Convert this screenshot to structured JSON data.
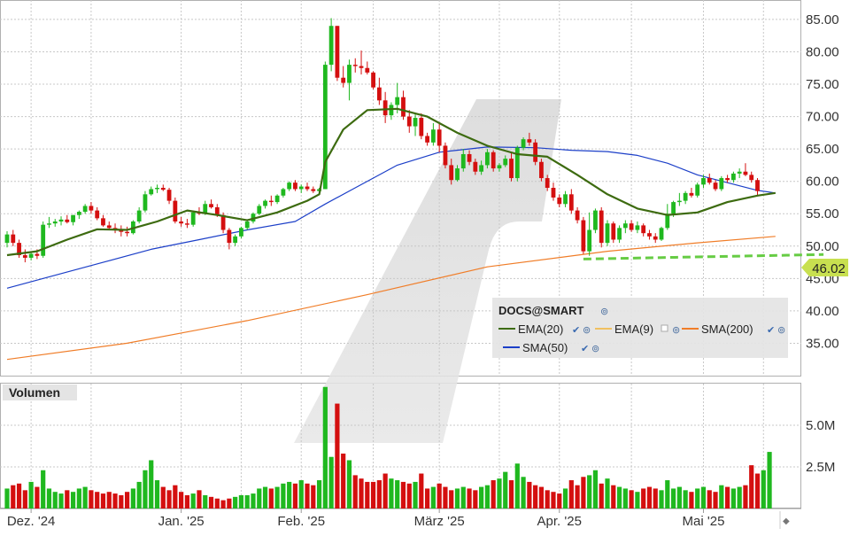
{
  "colors": {
    "up": "#1fb81f",
    "down": "#d40f0f",
    "ema20": "#3d6b10",
    "ema9": "#f0c060",
    "sma200": "#f07d28",
    "sma50": "#1c3fc8",
    "trend": "#66cc44",
    "last_badge": "#c8e050"
  },
  "legend": {
    "symbol": "DOCS@SMART",
    "items": [
      {
        "label": "EMA(20)",
        "color": "#3d6b10"
      },
      {
        "label": "EMA(9)",
        "color": "#f0c060"
      },
      {
        "label": "SMA(200)",
        "color": "#f07d28"
      },
      {
        "label": "SMA(50)",
        "color": "#1c3fc8"
      }
    ]
  },
  "volume_panel": {
    "title": "Volumen"
  },
  "last_price_label": "46.02",
  "chart_data": [
    {
      "type": "candlestick",
      "panel": "price",
      "ylim": [
        30,
        88
      ],
      "yticks": [
        35,
        40,
        45,
        50,
        55,
        60,
        65,
        70,
        75,
        80,
        85
      ],
      "ytick_labels": [
        "35.00",
        "40.00",
        "45.00",
        "50.00",
        "55.00",
        "60.00",
        "65.00",
        "70.00",
        "75.00",
        "80.00",
        "85.00"
      ],
      "x_labels": [
        {
          "label": "Dez. '24",
          "index": 4
        },
        {
          "label": "Jan. '25",
          "index": 29
        },
        {
          "label": "Feb. '25",
          "index": 49
        },
        {
          "label": "März '25",
          "index": 72
        },
        {
          "label": "Apr. '25",
          "index": 92
        },
        {
          "label": "Mai '25",
          "index": 116
        }
      ],
      "grid": true,
      "candles": [
        [
          50.5,
          52.3,
          49.8,
          51.8
        ],
        [
          51.8,
          52.5,
          50.0,
          50.5
        ],
        [
          50.5,
          51.0,
          48.2,
          48.6
        ],
        [
          48.6,
          49.5,
          47.5,
          48.2
        ],
        [
          48.2,
          49.0,
          47.8,
          48.8
        ],
        [
          48.8,
          49.5,
          48.0,
          48.5
        ],
        [
          48.5,
          53.8,
          48.2,
          53.3
        ],
        [
          53.3,
          54.5,
          52.8,
          53.5
        ],
        [
          53.5,
          54.2,
          53.0,
          53.8
        ],
        [
          53.8,
          54.6,
          53.2,
          54.1
        ],
        [
          54.1,
          54.8,
          53.5,
          53.7
        ],
        [
          53.7,
          54.5,
          53.2,
          54.8
        ],
        [
          54.8,
          55.5,
          54.2,
          55.3
        ],
        [
          55.3,
          56.5,
          55.0,
          56.2
        ],
        [
          56.2,
          56.8,
          55.0,
          55.5
        ],
        [
          55.5,
          56.0,
          54.0,
          54.3
        ],
        [
          54.3,
          54.8,
          53.0,
          53.2
        ],
        [
          53.2,
          53.8,
          52.5,
          52.8
        ],
        [
          52.8,
          53.5,
          52.0,
          52.6
        ],
        [
          52.6,
          53.2,
          51.5,
          52.2
        ],
        [
          52.2,
          53.0,
          51.5,
          52.0
        ],
        [
          52.0,
          54.0,
          51.8,
          53.8
        ],
        [
          53.8,
          56.0,
          53.5,
          55.5
        ],
        [
          55.5,
          58.5,
          55.2,
          58.0
        ],
        [
          58.0,
          59.2,
          57.8,
          58.8
        ],
        [
          58.8,
          59.5,
          58.2,
          59.0
        ],
        [
          59.0,
          59.5,
          58.5,
          58.7
        ],
        [
          58.7,
          59.0,
          56.5,
          57.0
        ],
        [
          57.0,
          57.5,
          53.5,
          53.8
        ],
        [
          53.8,
          54.5,
          53.0,
          53.5
        ],
        [
          53.5,
          54.2,
          52.8,
          53.3
        ],
        [
          53.3,
          55.5,
          53.0,
          55.2
        ],
        [
          55.2,
          56.0,
          54.8,
          55.0
        ],
        [
          55.0,
          57.0,
          54.8,
          56.5
        ],
        [
          56.5,
          57.2,
          55.8,
          56.0
        ],
        [
          56.0,
          56.5,
          54.5,
          54.8
        ],
        [
          54.8,
          55.2,
          52.0,
          52.5
        ],
        [
          52.5,
          52.8,
          49.5,
          50.5
        ],
        [
          50.5,
          51.8,
          50.0,
          51.5
        ],
        [
          51.5,
          53.0,
          51.2,
          52.8
        ],
        [
          52.8,
          54.0,
          52.5,
          53.8
        ],
        [
          53.8,
          55.2,
          53.5,
          55.0
        ],
        [
          55.0,
          56.5,
          54.8,
          56.2
        ],
        [
          56.2,
          57.2,
          55.8,
          57.0
        ],
        [
          57.0,
          57.8,
          56.2,
          56.8
        ],
        [
          56.8,
          58.0,
          56.5,
          57.8
        ],
        [
          57.8,
          59.0,
          57.5,
          58.8
        ],
        [
          58.8,
          60.0,
          58.5,
          59.8
        ],
        [
          59.8,
          60.2,
          58.5,
          58.8
        ],
        [
          58.8,
          59.5,
          58.2,
          59.2
        ],
        [
          59.2,
          59.8,
          58.5,
          58.8
        ],
        [
          58.8,
          59.2,
          58.2,
          58.5
        ],
        [
          58.5,
          59.0,
          58.0,
          58.8
        ],
        [
          58.8,
          78.5,
          71.5,
          78.0
        ],
        [
          78.0,
          85.2,
          77.0,
          84.0
        ],
        [
          84.0,
          82.0,
          75.5,
          76.0
        ],
        [
          76.0,
          77.8,
          74.5,
          75.2
        ],
        [
          75.2,
          78.8,
          72.5,
          78.0
        ],
        [
          78.0,
          79.0,
          76.8,
          77.8
        ],
        [
          77.8,
          80.2,
          76.5,
          77.5
        ],
        [
          77.5,
          78.5,
          76.5,
          76.8
        ],
        [
          76.8,
          77.0,
          74.2,
          74.5
        ],
        [
          74.5,
          76.0,
          71.8,
          72.5
        ],
        [
          72.5,
          73.8,
          69.0,
          70.2
        ],
        [
          70.2,
          72.2,
          69.5,
          71.8
        ],
        [
          71.8,
          75.2,
          70.5,
          73.0
        ],
        [
          73.0,
          74.0,
          69.5,
          70.0
        ],
        [
          70.0,
          71.0,
          67.5,
          68.5
        ],
        [
          68.5,
          70.5,
          67.0,
          69.8
        ],
        [
          69.8,
          70.5,
          66.5,
          67.0
        ],
        [
          67.0,
          67.5,
          65.5,
          66.0
        ],
        [
          66.0,
          69.0,
          65.5,
          68.0
        ],
        [
          68.0,
          69.0,
          64.5,
          65.5
        ],
        [
          65.5,
          66.0,
          62.0,
          62.5
        ],
        [
          62.5,
          63.5,
          59.5,
          60.2
        ],
        [
          60.2,
          62.5,
          60.0,
          62.0
        ],
        [
          62.0,
          65.0,
          61.5,
          64.2
        ],
        [
          64.2,
          64.8,
          62.5,
          63.0
        ],
        [
          63.0,
          63.5,
          61.0,
          61.5
        ],
        [
          61.5,
          63.2,
          61.0,
          62.5
        ],
        [
          62.5,
          65.0,
          62.0,
          64.5
        ],
        [
          64.5,
          64.8,
          61.5,
          62.0
        ],
        [
          62.0,
          62.8,
          61.5,
          62.5
        ],
        [
          62.5,
          64.0,
          62.2,
          63.5
        ],
        [
          63.5,
          64.5,
          60.0,
          60.5
        ],
        [
          60.5,
          65.5,
          60.0,
          65.2
        ],
        [
          65.2,
          66.8,
          64.8,
          66.5
        ],
        [
          66.5,
          67.5,
          65.5,
          66.0
        ],
        [
          66.0,
          66.5,
          62.5,
          63.0
        ],
        [
          63.0,
          63.5,
          60.0,
          60.5
        ],
        [
          60.5,
          61.0,
          58.5,
          59.0
        ],
        [
          59.0,
          59.8,
          57.0,
          57.5
        ],
        [
          57.5,
          58.0,
          56.0,
          56.5
        ],
        [
          56.5,
          58.5,
          56.0,
          58.0
        ],
        [
          58.0,
          58.8,
          55.0,
          55.5
        ],
        [
          55.5,
          56.0,
          53.5,
          54.0
        ],
        [
          54.0,
          54.5,
          48.8,
          49.2
        ],
        [
          49.2,
          55.2,
          48.5,
          52.5
        ],
        [
          52.5,
          55.8,
          52.0,
          55.5
        ],
        [
          55.5,
          56.0,
          49.8,
          50.5
        ],
        [
          50.5,
          54.0,
          50.0,
          53.5
        ],
        [
          53.5,
          53.8,
          50.5,
          51.0
        ],
        [
          51.0,
          53.2,
          50.5,
          52.8
        ],
        [
          52.8,
          54.0,
          52.0,
          53.5
        ],
        [
          53.5,
          54.0,
          52.2,
          52.5
        ],
        [
          52.5,
          53.8,
          52.0,
          53.2
        ],
        [
          53.2,
          53.5,
          51.5,
          52.0
        ],
        [
          52.0,
          52.5,
          51.0,
          51.5
        ],
        [
          51.5,
          52.0,
          50.5,
          51.0
        ],
        [
          51.0,
          53.0,
          50.8,
          52.8
        ],
        [
          52.8,
          56.5,
          52.5,
          55.0
        ],
        [
          55.0,
          57.0,
          54.5,
          56.8
        ],
        [
          56.8,
          58.2,
          56.2,
          57.0
        ],
        [
          57.0,
          58.5,
          56.5,
          58.2
        ],
        [
          58.2,
          59.0,
          57.5,
          57.8
        ],
        [
          57.8,
          59.8,
          57.5,
          59.5
        ],
        [
          59.5,
          61.0,
          59.0,
          60.5
        ],
        [
          60.5,
          61.2,
          59.5,
          59.8
        ],
        [
          59.8,
          60.2,
          58.5,
          58.8
        ],
        [
          58.8,
          60.8,
          58.5,
          60.5
        ],
        [
          60.5,
          61.0,
          59.8,
          60.2
        ],
        [
          60.2,
          61.5,
          59.8,
          61.2
        ],
        [
          61.2,
          62.0,
          60.5,
          61.5
        ],
        [
          61.5,
          62.8,
          60.8,
          61.0
        ],
        [
          61.0,
          61.5,
          59.8,
          60.2
        ],
        [
          60.2,
          60.5,
          57.8,
          58.5
        ]
      ],
      "overlays": {
        "ema20": [
          [
            0,
            48.6
          ],
          [
            5,
            49.2
          ],
          [
            10,
            51.0
          ],
          [
            15,
            52.6
          ],
          [
            20,
            52.5
          ],
          [
            25,
            53.8
          ],
          [
            30,
            55.5
          ],
          [
            35,
            54.8
          ],
          [
            40,
            54.0
          ],
          [
            45,
            55.2
          ],
          [
            50,
            57.0
          ],
          [
            52,
            58.0
          ],
          [
            53,
            63.0
          ],
          [
            56,
            68.0
          ],
          [
            60,
            71.0
          ],
          [
            65,
            71.2
          ],
          [
            70,
            70.0
          ],
          [
            75,
            67.5
          ],
          [
            80,
            65.5
          ],
          [
            85,
            64.2
          ],
          [
            90,
            63.8
          ],
          [
            95,
            61.0
          ],
          [
            100,
            58.0
          ],
          [
            105,
            55.8
          ],
          [
            110,
            54.8
          ],
          [
            115,
            55.2
          ],
          [
            120,
            56.8
          ],
          [
            125,
            57.8
          ],
          [
            128,
            58.2
          ]
        ],
        "sma50": [
          [
            0,
            43.5
          ],
          [
            8,
            45.5
          ],
          [
            16,
            47.5
          ],
          [
            24,
            49.5
          ],
          [
            32,
            51.0
          ],
          [
            40,
            52.5
          ],
          [
            48,
            53.8
          ],
          [
            53,
            56.5
          ],
          [
            58,
            59.0
          ],
          [
            65,
            62.5
          ],
          [
            72,
            64.5
          ],
          [
            80,
            65.3
          ],
          [
            88,
            65.2
          ],
          [
            94,
            64.8
          ],
          [
            100,
            64.6
          ],
          [
            105,
            64.0
          ],
          [
            110,
            62.8
          ],
          [
            115,
            61.0
          ],
          [
            120,
            59.8
          ],
          [
            125,
            58.6
          ],
          [
            128,
            58.2
          ]
        ],
        "sma200": [
          [
            0,
            32.5
          ],
          [
            20,
            35.0
          ],
          [
            40,
            38.5
          ],
          [
            60,
            42.5
          ],
          [
            80,
            46.8
          ],
          [
            100,
            49.2
          ],
          [
            115,
            50.5
          ],
          [
            128,
            51.5
          ]
        ],
        "trend": [
          [
            96,
            48.0
          ],
          [
            136,
            48.7
          ]
        ]
      }
    },
    {
      "type": "bar",
      "panel": "volume",
      "ylim": [
        0,
        7500000
      ],
      "yticks": [
        2500000,
        5000000
      ],
      "ytick_labels": [
        "2.5M",
        "5.0M"
      ],
      "values": [
        1200000,
        1400000,
        1500000,
        1100000,
        1600000,
        1300000,
        2300000,
        1200000,
        1000000,
        900000,
        1100000,
        1000000,
        1200000,
        1300000,
        1100000,
        1000000,
        900000,
        1000000,
        900000,
        800000,
        1000000,
        1200000,
        1600000,
        2300000,
        2900000,
        1700000,
        1300000,
        1100000,
        1400000,
        1000000,
        800000,
        900000,
        1100000,
        800000,
        700000,
        600000,
        500000,
        600000,
        700000,
        800000,
        800000,
        900000,
        1200000,
        1300000,
        1200000,
        1300000,
        1500000,
        1600000,
        1500000,
        1700000,
        1500000,
        1400000,
        1700000,
        7300000,
        3100000,
        6300000,
        3300000,
        2900000,
        2000000,
        1800000,
        1600000,
        1600000,
        1700000,
        2100000,
        1800000,
        1700000,
        1600000,
        1500000,
        1600000,
        2100000,
        1200000,
        1300000,
        1500000,
        1300000,
        1100000,
        1200000,
        1300000,
        1200000,
        1100000,
        1300000,
        1400000,
        1700000,
        1800000,
        2200000,
        1700000,
        2700000,
        1900000,
        1600000,
        1400000,
        1300000,
        1100000,
        1000000,
        900000,
        1200000,
        1700000,
        1400000,
        1900000,
        2000000,
        2300000,
        1500000,
        1800000,
        1400000,
        1300000,
        1200000,
        1100000,
        1000000,
        1200000,
        1300000,
        1200000,
        1100000,
        1700000,
        1200000,
        1300000,
        1100000,
        1000000,
        1200000,
        1300000,
        1100000,
        1000000,
        1400000,
        1300000,
        1200000,
        1300000,
        1400000,
        2600000,
        2100000,
        2300000,
        3400000
      ]
    }
  ]
}
